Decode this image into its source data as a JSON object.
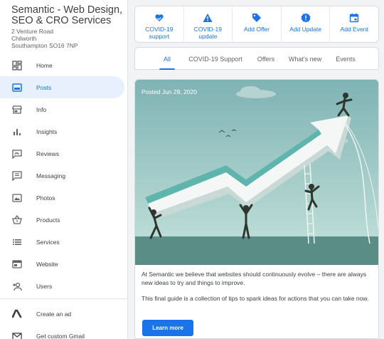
{
  "business": {
    "name": "Semantic - Web Design, SEO & CRO Services",
    "address_line1": "2 Venture Road",
    "address_line2": "Chilworth",
    "address_line3": "Southampton SO16 7NP"
  },
  "sidebar": {
    "items": [
      {
        "label": "Home",
        "icon": "dashboard-icon"
      },
      {
        "label": "Posts",
        "icon": "posts-icon",
        "active": true
      },
      {
        "label": "Info",
        "icon": "store-icon"
      },
      {
        "label": "Insights",
        "icon": "bar-chart-icon"
      },
      {
        "label": "Reviews",
        "icon": "reviews-icon"
      },
      {
        "label": "Messaging",
        "icon": "chat-icon"
      },
      {
        "label": "Photos",
        "icon": "photo-icon"
      },
      {
        "label": "Products",
        "icon": "basket-icon"
      },
      {
        "label": "Services",
        "icon": "list-icon"
      },
      {
        "label": "Website",
        "icon": "web-icon"
      },
      {
        "label": "Users",
        "icon": "add-user-icon"
      }
    ],
    "bottom_items": [
      {
        "label": "Create an ad",
        "icon": "google-ads-icon"
      },
      {
        "label": "Get custom Gmail",
        "icon": "gmail-icon"
      }
    ]
  },
  "actions": [
    {
      "label_line1": "COVID-19",
      "label_line2": "support",
      "icon": "heart-hands-icon"
    },
    {
      "label_line1": "COVID-19",
      "label_line2": "update",
      "icon": "warning-icon"
    },
    {
      "label_line1": "Add Offer",
      "label_line2": "",
      "icon": "tag-icon"
    },
    {
      "label_line1": "Add Update",
      "label_line2": "",
      "icon": "update-badge-icon"
    },
    {
      "label_line1": "Add Event",
      "label_line2": "",
      "icon": "calendar-icon"
    }
  ],
  "tabs": [
    {
      "label": "All",
      "active": true
    },
    {
      "label": "COVID-19 Support"
    },
    {
      "label": "Offers"
    },
    {
      "label": "What's new"
    },
    {
      "label": "Events"
    }
  ],
  "post": {
    "posted": "Posted Jun 29, 2020",
    "body1": "At Semantic we believe that websites should continuously evolve – there are always new ideas to try and things to improve.",
    "body2": "This final guide is a collection of tips to spark ideas for actions that you can take now.",
    "button": "Learn more"
  },
  "colors": {
    "accent": "#1a73e8",
    "active_bg": "#e8f0fe",
    "sky_top": "#7fb3b4",
    "sky_bottom": "#c6e3dc",
    "arrow_teal": "#5fb5ad"
  }
}
